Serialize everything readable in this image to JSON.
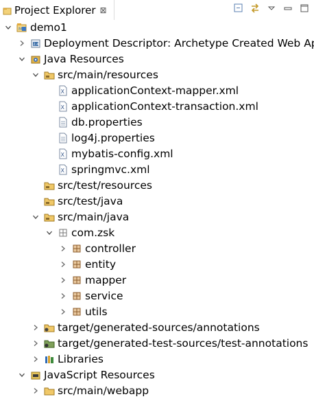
{
  "view": {
    "title": "Project Explorer",
    "close_glyph": "⊠",
    "toolbar": [
      "collapse-all-icon",
      "link-with-editor-icon",
      "view-menu-icon",
      "minimize-icon",
      "maximize-icon"
    ]
  },
  "tree": [
    {
      "label": "demo1",
      "icon": "project-icon",
      "state": "expanded"
    },
    {
      "label": "Deployment Descriptor: Archetype Created Web Ap",
      "icon": "deployment-descriptor-icon",
      "state": "collapsed"
    },
    {
      "label": "Java Resources",
      "icon": "java-resources-icon",
      "state": "expanded"
    },
    {
      "label": "src/main/resources",
      "icon": "source-folder-icon",
      "state": "expanded"
    },
    {
      "label": "applicationContext-mapper.xml",
      "icon": "xml-file-icon",
      "state": "leaf"
    },
    {
      "label": "applicationContext-transaction.xml",
      "icon": "xml-file-icon",
      "state": "leaf"
    },
    {
      "label": "db.properties",
      "icon": "text-file-icon",
      "state": "leaf"
    },
    {
      "label": "log4j.properties",
      "icon": "text-file-icon",
      "state": "leaf"
    },
    {
      "label": "mybatis-config.xml",
      "icon": "xml-file-icon",
      "state": "leaf"
    },
    {
      "label": "springmvc.xml",
      "icon": "xml-file-icon",
      "state": "leaf"
    },
    {
      "label": "src/test/resources",
      "icon": "source-folder-icon",
      "state": "leaf"
    },
    {
      "label": "src/test/java",
      "icon": "source-folder-icon",
      "state": "leaf"
    },
    {
      "label": "src/main/java",
      "icon": "source-folder-icon",
      "state": "expanded"
    },
    {
      "label": "com.zsk",
      "icon": "empty-package-icon",
      "state": "expanded"
    },
    {
      "label": "controller",
      "icon": "package-icon",
      "state": "collapsed"
    },
    {
      "label": "entity",
      "icon": "package-icon",
      "state": "collapsed"
    },
    {
      "label": "mapper",
      "icon": "package-icon",
      "state": "collapsed"
    },
    {
      "label": "service",
      "icon": "package-icon",
      "state": "collapsed"
    },
    {
      "label": "utils",
      "icon": "package-icon",
      "state": "collapsed"
    },
    {
      "label": "target/generated-sources/annotations",
      "icon": "generated-source-folder-icon",
      "state": "collapsed"
    },
    {
      "label": "target/generated-test-sources/test-annotations",
      "icon": "generated-test-source-folder-icon",
      "state": "collapsed"
    },
    {
      "label": "Libraries",
      "icon": "libraries-icon",
      "state": "collapsed"
    },
    {
      "label": "JavaScript Resources",
      "icon": "javascript-resources-icon",
      "state": "expanded"
    },
    {
      "label": "src/main/webapp",
      "icon": "folder-icon",
      "state": "collapsed"
    }
  ]
}
